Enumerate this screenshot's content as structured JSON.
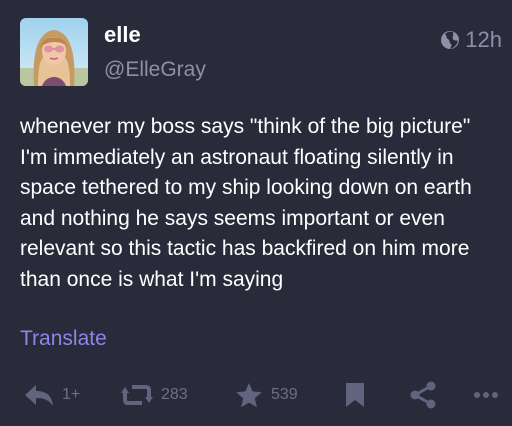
{
  "account": {
    "display_name": "elle",
    "handle": "@ElleGray"
  },
  "visibility": {
    "icon": "globe-icon",
    "relative_time": "12h"
  },
  "status": {
    "lines": [
      "whenever my boss says \"think of the big picture\"",
      "I'm immediately an astronaut floating silently in",
      "space tethered to my ship looking down on earth",
      "and nothing he says seems important or even",
      "relevant so this tactic has backfired on him more",
      "than once is what I'm saying"
    ]
  },
  "translate_label": "Translate",
  "actions": {
    "reply": {
      "icon": "reply-icon",
      "count": "1+"
    },
    "reblog": {
      "icon": "reblog-icon",
      "count": "283"
    },
    "favourite": {
      "icon": "star-icon",
      "count": "539"
    },
    "bookmark": {
      "icon": "bookmark-icon"
    },
    "share": {
      "icon": "share-icon"
    },
    "more": {
      "icon": "more-icon"
    }
  },
  "colors": {
    "background": "#2a2b3a",
    "text": "#ffffff",
    "muted": "#8d90a8",
    "accent": "#8b86e6",
    "icon": "#60647e"
  }
}
